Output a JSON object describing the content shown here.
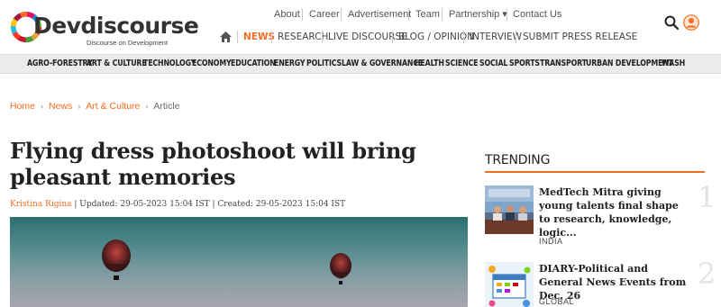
{
  "brand": {
    "name": "Devdiscourse",
    "tagline": "Discourse on Development"
  },
  "top_nav": [
    "About",
    "Career",
    "Advertisement",
    "Team",
    "Partnership ▾",
    "Contact Us"
  ],
  "main_nav": {
    "home_icon": "home-icon",
    "items": [
      "NEWS",
      "RESEARCH",
      "LIVE DISCOURSE",
      "BLOG / OPINION",
      "INTERVIEW",
      "SUBMIT PRESS RELEASE"
    ],
    "active": "NEWS"
  },
  "header_icons": [
    "search-icon",
    "user-icon"
  ],
  "categories": [
    "AGRO-FORESTRY",
    "ART & CULTURE",
    "TECHNOLOGY",
    "ECONOMY",
    "EDUCATION",
    "ENERGY",
    "POLITICS",
    "LAW & GOVERNANCE",
    "HEALTH",
    "SCIENCE",
    "SOCIAL",
    "SPORTS",
    "TRANSPORT",
    "URBAN DEVELOPMENT",
    "WASH"
  ],
  "breadcrumb": {
    "links": [
      "Home",
      "News",
      "Art & Culture"
    ],
    "current": "Article"
  },
  "article": {
    "title": "Flying dress photoshoot will bring pleasant memories",
    "author": "Kristina Rigina",
    "updated": "| Updated: 29-05-2023 15:04 IST",
    "created": "| Created: 29-05-2023 15:04 IST"
  },
  "trending": {
    "heading": "TRENDING",
    "items": [
      {
        "rank": "1",
        "title": "MedTech Mitra giving young talents final shape to research, knowledge, logic...",
        "tag": "INDIA"
      },
      {
        "rank": "2",
        "title": "DIARY-Political and General News Events from Dec. 26",
        "tag": "GLOBAL"
      }
    ]
  },
  "colors": {
    "accent": "#f36c21",
    "catbar": "#ebebeb"
  }
}
